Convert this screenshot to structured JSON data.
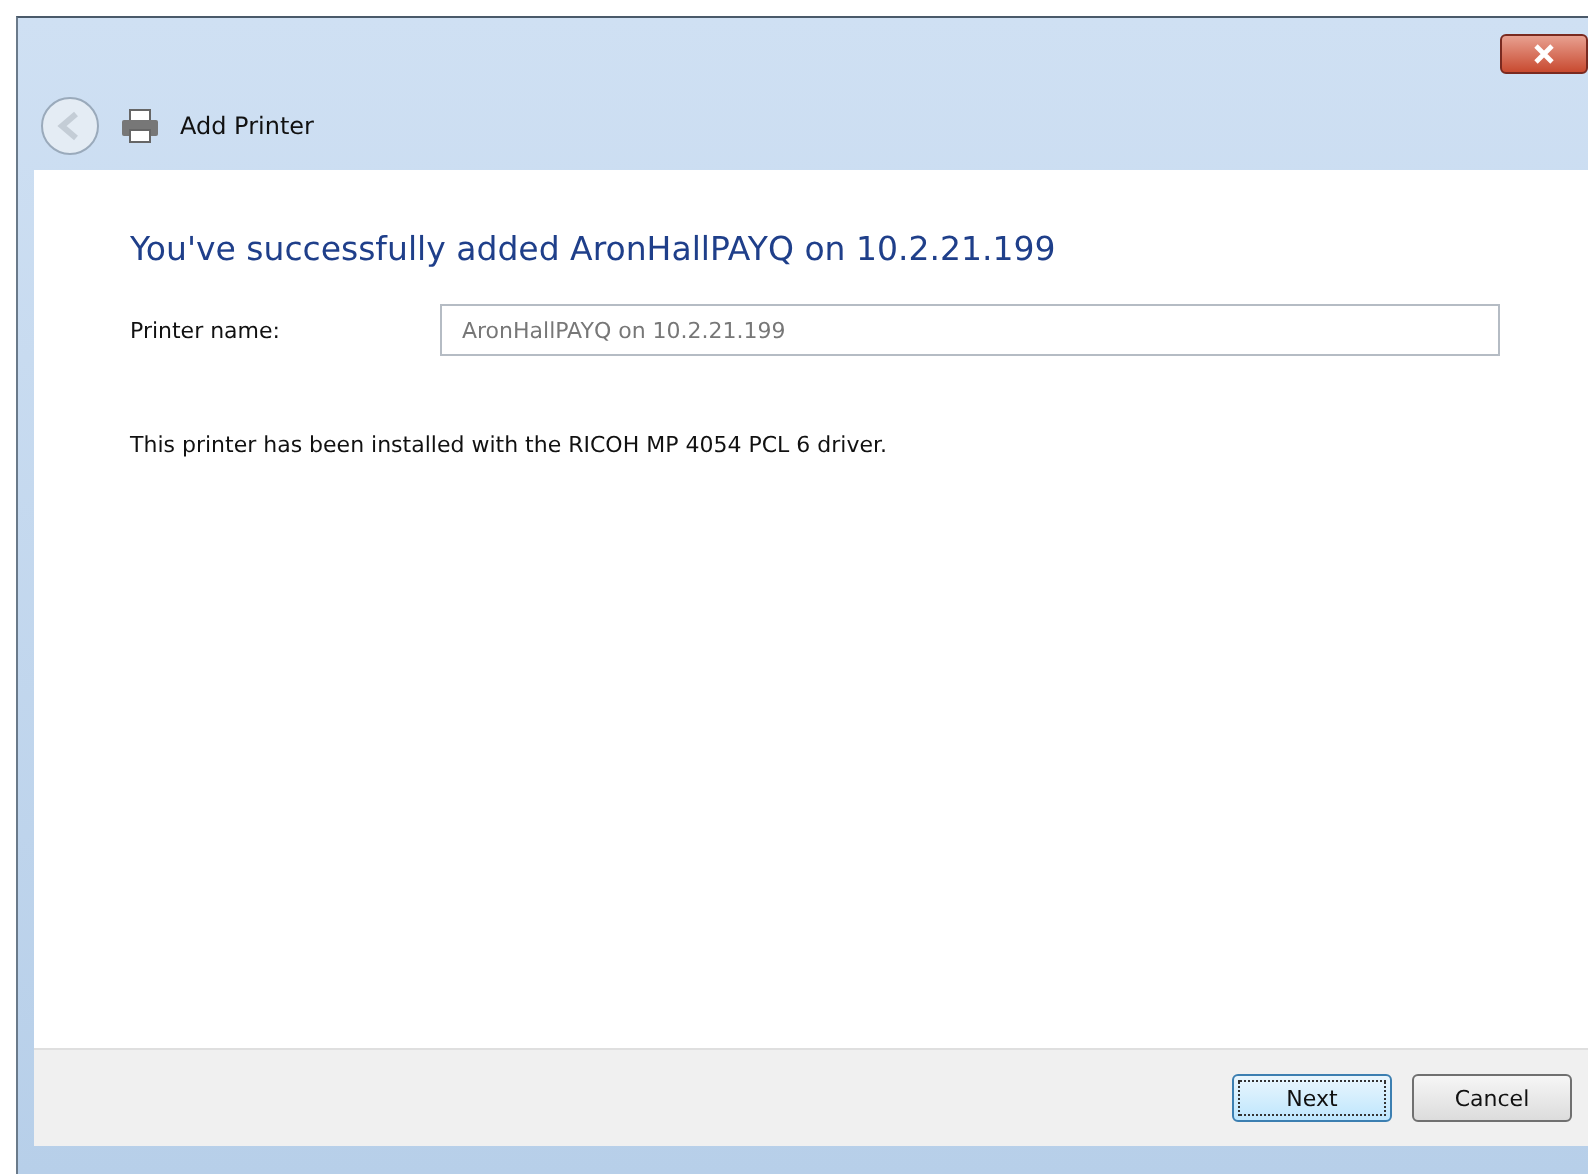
{
  "window": {
    "title": "Add Printer"
  },
  "heading": "You've successfully added AronHallPAYQ on 10.2.21.199",
  "printer_name": {
    "label": "Printer name:",
    "value": "AronHallPAYQ on 10.2.21.199"
  },
  "message": "This printer has been installed with the RICOH MP 4054 PCL 6 driver.",
  "buttons": [
    {
      "label": "Next",
      "focused": true
    },
    {
      "label": "Cancel",
      "focused": false
    }
  ]
}
